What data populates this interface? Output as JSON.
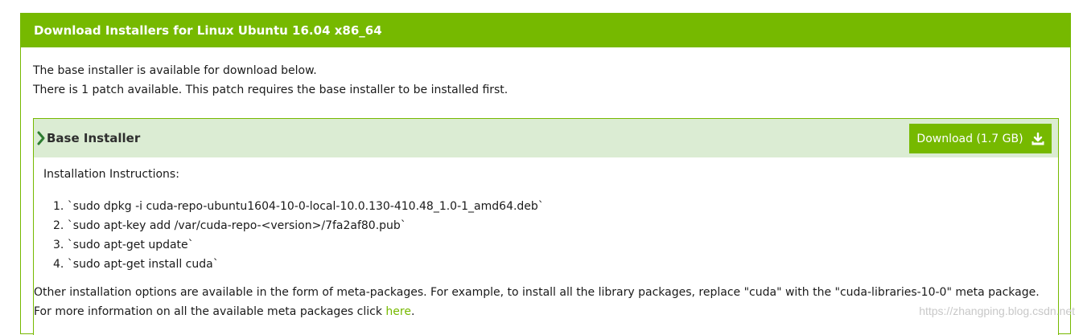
{
  "header": {
    "title": "Download Installers for Linux Ubuntu 16.04 x86_64"
  },
  "intro": {
    "line1": "The base installer is available for download below.",
    "line2": "There is 1 patch available. This patch requires the base installer to be installed first."
  },
  "base_installer": {
    "title": "Base Installer",
    "download_label": "Download (1.7 GB)",
    "instructions_title": "Installation Instructions:",
    "steps": [
      "1. `sudo dpkg -i cuda-repo-ubuntu1604-10-0-local-10.0.130-410.48_1.0-1_amd64.deb`",
      "2. `sudo apt-key add /var/cuda-repo-<version>/7fa2af80.pub`",
      "3. `sudo apt-get update`",
      "4. `sudo apt-get install cuda`"
    ],
    "other_line1": "Other installation options are available in the form of meta-packages. For example, to install all the library packages, replace \"cuda\" with the \"cuda-libraries-10-0\" meta package.",
    "other_line2_prefix": "For more information on all the available meta packages click ",
    "other_link": "here",
    "other_line2_suffix": "."
  },
  "watermark": "https://zhangping.blog.csdn.net",
  "colors": {
    "accent": "#76b900",
    "section_bg": "#dbecd3"
  },
  "icons": {
    "chevron": "chevron-right-icon",
    "download": "download-icon"
  }
}
